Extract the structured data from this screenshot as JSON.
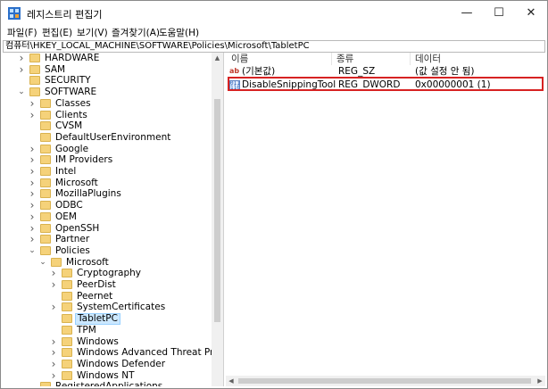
{
  "window": {
    "title": "레지스트리 편집기"
  },
  "controls": {
    "minimize": "—",
    "maximize": "☐",
    "close": "✕"
  },
  "menu": [
    "파일(F)",
    "편집(E)",
    "보기(V)",
    "즐겨찾기(A)",
    "도움말(H)"
  ],
  "address": "컴퓨터\\HKEY_LOCAL_MACHINE\\SOFTWARE\\Policies\\Microsoft\\TabletPC",
  "tree": [
    {
      "label": "HARDWARE",
      "level": 1,
      "expand": "collapsed"
    },
    {
      "label": "SAM",
      "level": 1,
      "expand": "collapsed"
    },
    {
      "label": "SECURITY",
      "level": 1,
      "expand": "none"
    },
    {
      "label": "SOFTWARE",
      "level": 1,
      "expand": "expanded"
    },
    {
      "label": "Classes",
      "level": 2,
      "expand": "collapsed"
    },
    {
      "label": "Clients",
      "level": 2,
      "expand": "collapsed"
    },
    {
      "label": "CVSM",
      "level": 2,
      "expand": "none"
    },
    {
      "label": "DefaultUserEnvironment",
      "level": 2,
      "expand": "none"
    },
    {
      "label": "Google",
      "level": 2,
      "expand": "collapsed"
    },
    {
      "label": "IM Providers",
      "level": 2,
      "expand": "collapsed"
    },
    {
      "label": "Intel",
      "level": 2,
      "expand": "collapsed"
    },
    {
      "label": "Microsoft",
      "level": 2,
      "expand": "collapsed"
    },
    {
      "label": "MozillaPlugins",
      "level": 2,
      "expand": "collapsed"
    },
    {
      "label": "ODBC",
      "level": 2,
      "expand": "collapsed"
    },
    {
      "label": "OEM",
      "level": 2,
      "expand": "collapsed"
    },
    {
      "label": "OpenSSH",
      "level": 2,
      "expand": "collapsed"
    },
    {
      "label": "Partner",
      "level": 2,
      "expand": "collapsed"
    },
    {
      "label": "Policies",
      "level": 2,
      "expand": "expanded"
    },
    {
      "label": "Microsoft",
      "level": 3,
      "expand": "expanded"
    },
    {
      "label": "Cryptography",
      "level": 4,
      "expand": "collapsed"
    },
    {
      "label": "PeerDist",
      "level": 4,
      "expand": "collapsed"
    },
    {
      "label": "Peernet",
      "level": 4,
      "expand": "none"
    },
    {
      "label": "SystemCertificates",
      "level": 4,
      "expand": "collapsed"
    },
    {
      "label": "TabletPC",
      "level": 4,
      "expand": "none",
      "selected": true
    },
    {
      "label": "TPM",
      "level": 4,
      "expand": "none"
    },
    {
      "label": "Windows",
      "level": 4,
      "expand": "collapsed"
    },
    {
      "label": "Windows Advanced Threat Protection",
      "level": 4,
      "expand": "collapsed"
    },
    {
      "label": "Windows Defender",
      "level": 4,
      "expand": "collapsed"
    },
    {
      "label": "Windows NT",
      "level": 4,
      "expand": "collapsed"
    },
    {
      "label": "RegisteredApplications",
      "level": 2,
      "expand": "none"
    }
  ],
  "columns": {
    "name": "이름",
    "type": "종류",
    "data": "데이터"
  },
  "values": [
    {
      "icon": "string-value-icon",
      "name": "(기본값)",
      "type": "REG_SZ",
      "data": "(값 설정 안 됨)"
    },
    {
      "icon": "binary-value-icon",
      "name": "DisableSnippingTool",
      "type": "REG_DWORD",
      "data": "0x00000001 (1)"
    }
  ],
  "highlight_color": "#d72222",
  "selection_color": "#cce8ff"
}
